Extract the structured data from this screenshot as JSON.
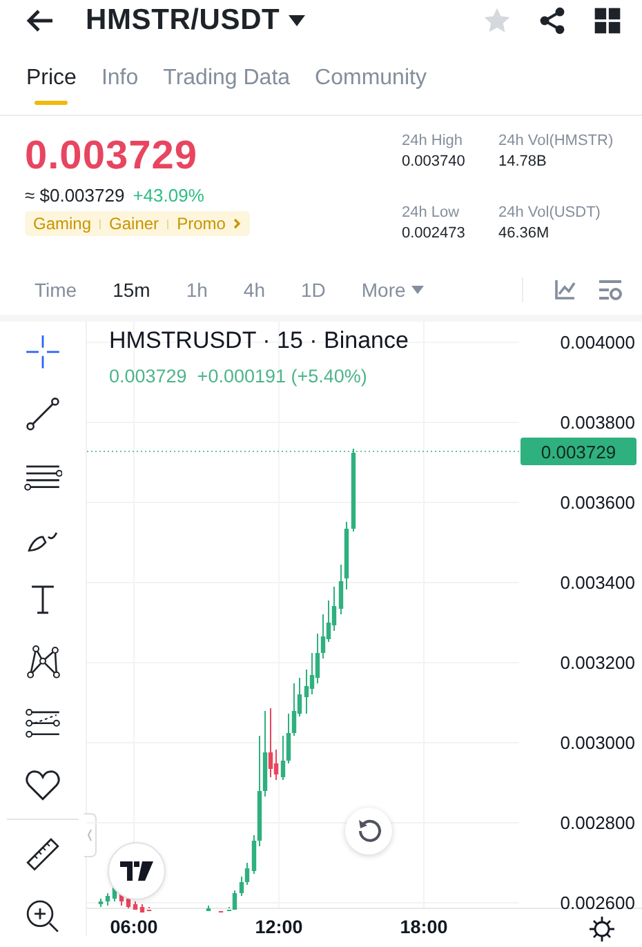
{
  "header": {
    "title": "HMSTR/USDT",
    "favorite": false
  },
  "tabs": [
    {
      "label": "Price",
      "selected": true
    },
    {
      "label": "Info",
      "selected": false
    },
    {
      "label": "Trading Data",
      "selected": false
    },
    {
      "label": "Community",
      "selected": false
    }
  ],
  "price": {
    "last": "0.003729",
    "approx": "≈ $0.003729",
    "change": "+43.09%",
    "tags": [
      "Gaming",
      "Gainer",
      "Promo"
    ]
  },
  "stats": [
    {
      "label": "24h High",
      "value": "0.003740"
    },
    {
      "label": "24h Vol(HMSTR)",
      "value": "14.78B"
    },
    {
      "label": "24h Low",
      "value": "0.002473"
    },
    {
      "label": "24h Vol(USDT)",
      "value": "46.36M"
    }
  ],
  "intervals": [
    {
      "label": "Time",
      "selected": false
    },
    {
      "label": "15m",
      "selected": true
    },
    {
      "label": "1h",
      "selected": false
    },
    {
      "label": "4h",
      "selected": false
    },
    {
      "label": "1D",
      "selected": false
    },
    {
      "label": "More",
      "selected": false
    }
  ],
  "chart": {
    "title": "HMSTRUSDT · 15 · Binance",
    "quote": "0.003729  +0.000191 (+5.40%)",
    "price_tag": "0.003729",
    "y_labels": [
      "0.004000",
      "0.003800",
      "0.003600",
      "0.003400",
      "0.003200",
      "0.003000",
      "0.002800",
      "0.002600"
    ],
    "x_labels": [
      "06:00",
      "12:00",
      "18:00"
    ]
  }
}
